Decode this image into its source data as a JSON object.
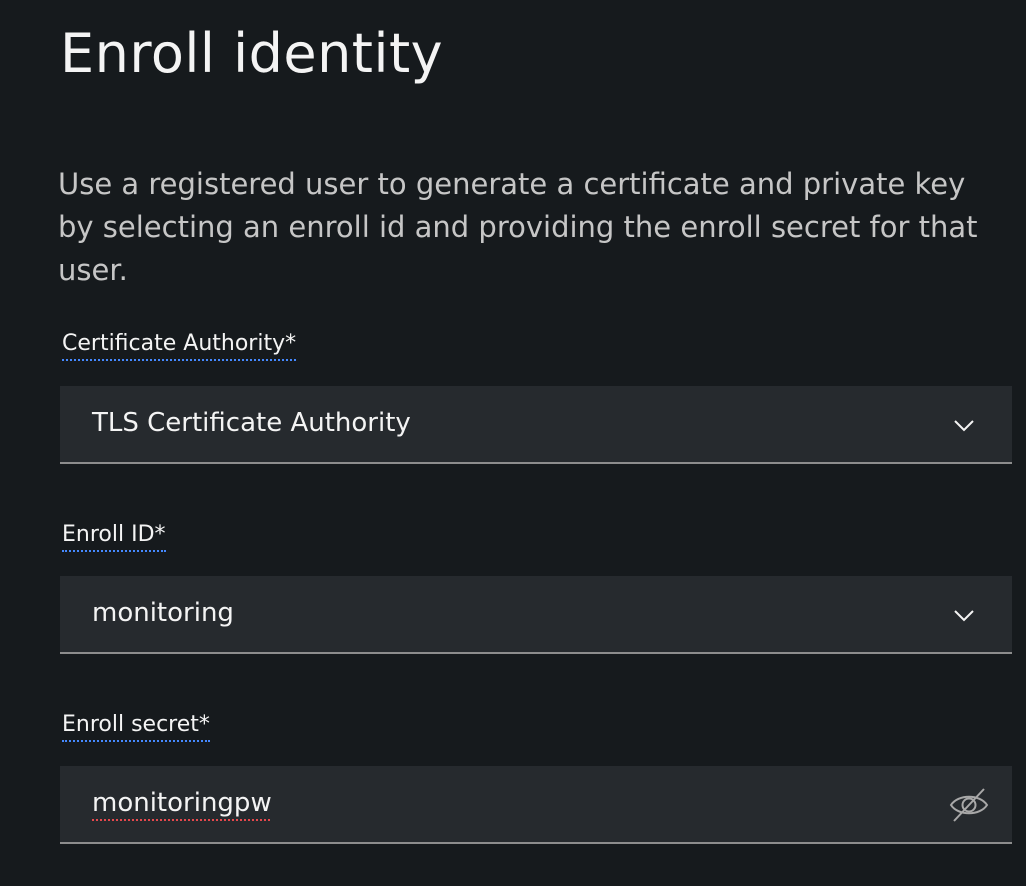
{
  "title": "Enroll identity",
  "description": "Use a registered user to generate a certificate and private key by selecting an enroll id and providing the enroll secret for that user.",
  "fields": {
    "ca": {
      "label": "Certificate Authority*",
      "value": "TLS Certificate Authority",
      "icon": "chevron-down-icon"
    },
    "enroll_id": {
      "label": "Enroll ID*",
      "value": "monitoring",
      "icon": "chevron-down-icon"
    },
    "enroll_secret": {
      "label": "Enroll secret*",
      "value": "monitoringpw",
      "icon": "eye-off-icon"
    }
  },
  "colors": {
    "background": "#161a1d",
    "field_background": "#262a2e",
    "label_underline": "#4589ff",
    "spellcheck_underline": "#e5484d"
  }
}
